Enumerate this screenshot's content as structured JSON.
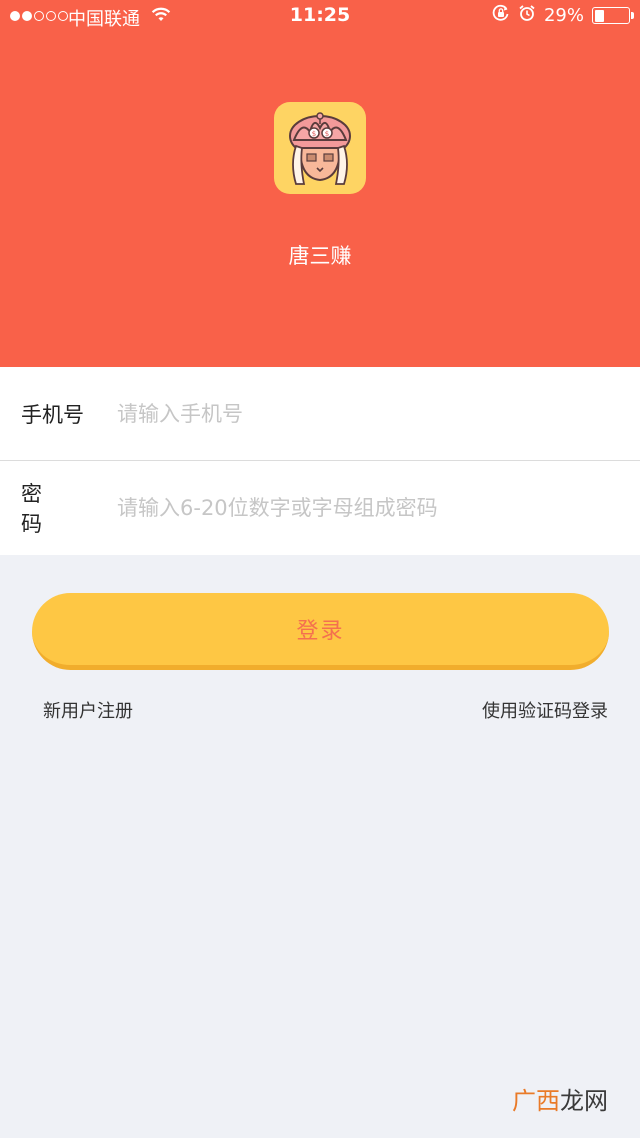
{
  "status_bar": {
    "carrier": "中国联通",
    "time": "11:25",
    "battery_percent": "29%",
    "battery_level": 0.29,
    "signal_bars_filled": 2,
    "signal_bars_total": 5
  },
  "app": {
    "name": "唐三赚",
    "icon": "tang-san-zhuan-logo-icon"
  },
  "form": {
    "phone_label": "手机号",
    "phone_placeholder": "请输入手机号",
    "password_label": "密码",
    "password_placeholder": "请输入6-20位数字或字母组成密码"
  },
  "actions": {
    "login_label": "登录",
    "register_label": "新用户注册",
    "sms_login_label": "使用验证码登录"
  },
  "watermark": {
    "part1": "广西",
    "part2": "龙网"
  },
  "colors": {
    "header_bg": "#f96149",
    "login_button": "#fec744",
    "login_text": "#f4704f",
    "page_bg": "#eff1f6"
  }
}
